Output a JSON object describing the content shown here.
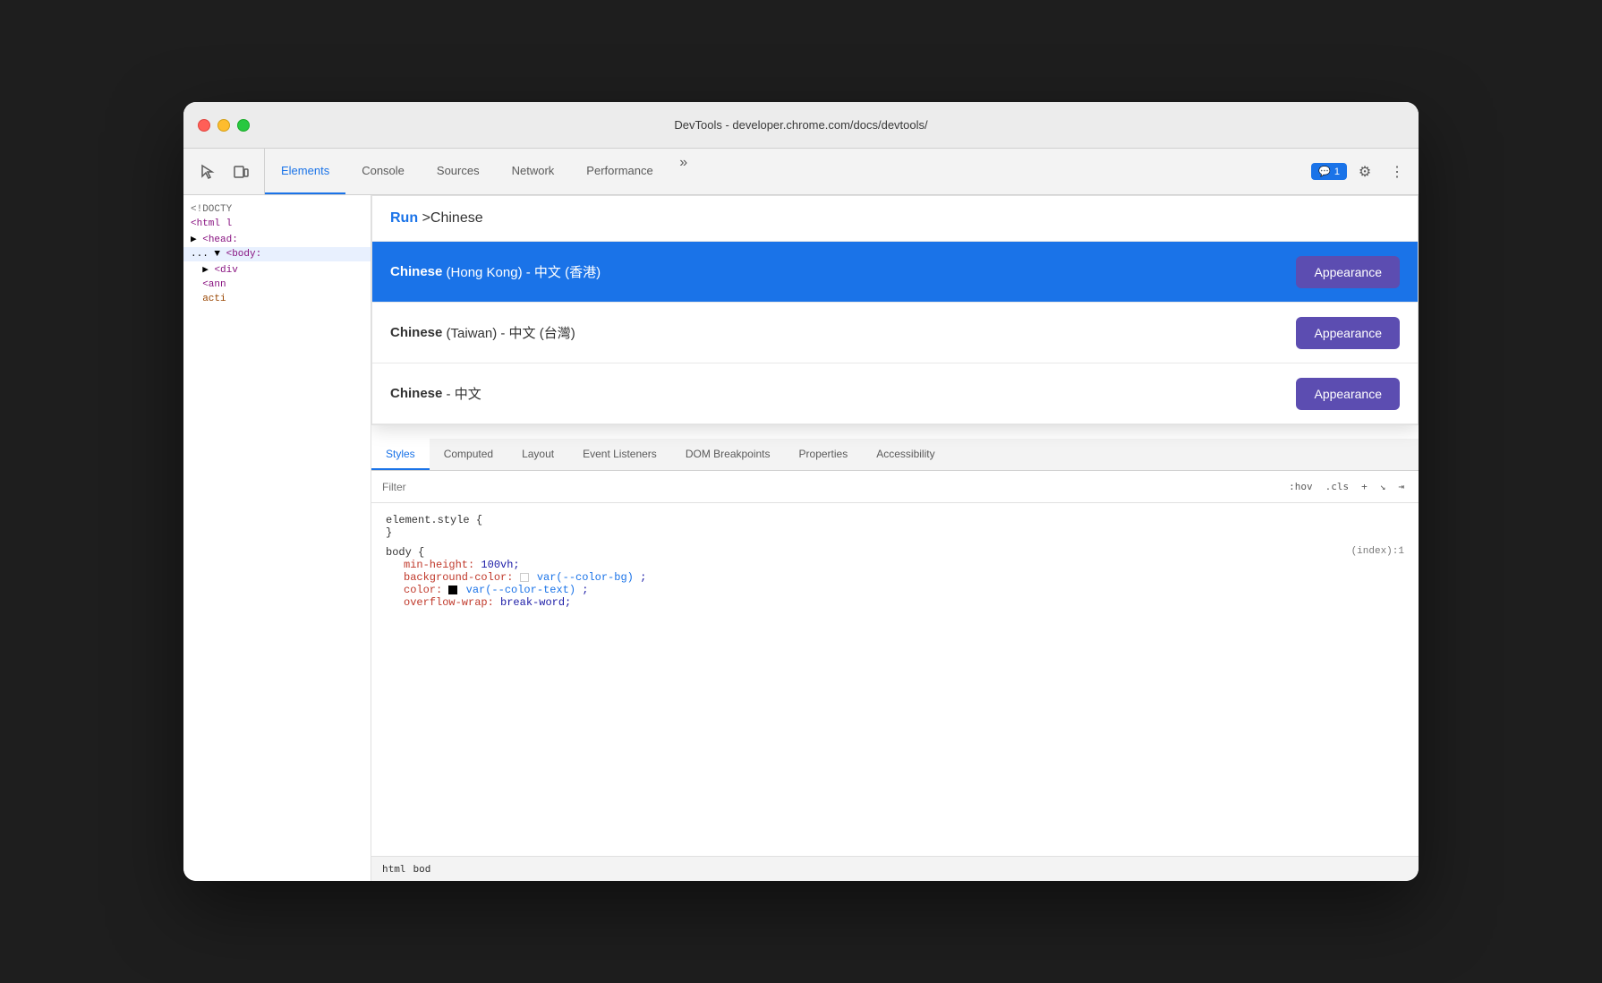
{
  "window": {
    "title": "DevTools - developer.chrome.com/docs/devtools/"
  },
  "toolbar": {
    "tabs": [
      {
        "label": "Elements",
        "active": false
      },
      {
        "label": "Console",
        "active": false
      },
      {
        "label": "Sources",
        "active": false
      },
      {
        "label": "Network",
        "active": false
      },
      {
        "label": "Performance",
        "active": false
      }
    ],
    "more_label": "»",
    "notification": "1",
    "settings_icon": "⚙",
    "menu_icon": "⋮"
  },
  "dom": {
    "lines": [
      {
        "text": "<!DOCTY",
        "type": "doctype"
      },
      {
        "text": "<html l",
        "type": "tag"
      },
      {
        "text": "▶ <head:",
        "type": "tag"
      },
      {
        "text": "... ▼ <body:",
        "type": "tag",
        "selected": true
      },
      {
        "text": "  ▶ <div",
        "type": "tag"
      },
      {
        "text": "  <ann",
        "type": "tag"
      },
      {
        "text": "  acti",
        "type": "attr"
      }
    ]
  },
  "command_palette": {
    "run_label": "Run",
    "query": ">Chinese",
    "results": [
      {
        "id": "result-1",
        "bold": "Chinese",
        "rest": " (Hong Kong) - 中文 (香港)",
        "button": "Appearance",
        "highlighted": true
      },
      {
        "id": "result-2",
        "bold": "Chinese",
        "rest": " (Taiwan) - 中文 (台灣)",
        "button": "Appearance",
        "highlighted": false
      },
      {
        "id": "result-3",
        "bold": "Chinese",
        "rest": " - 中文",
        "button": "Appearance",
        "highlighted": false
      }
    ]
  },
  "styles_tabs": [
    {
      "label": "Styles",
      "active": true
    },
    {
      "label": "Computed",
      "active": false
    },
    {
      "label": "Layout",
      "active": false
    },
    {
      "label": "Event Listeners",
      "active": false
    },
    {
      "label": "DOM Breakpoints",
      "active": false
    },
    {
      "label": "Properties",
      "active": false
    },
    {
      "label": "Accessibility",
      "active": false
    }
  ],
  "filter": {
    "placeholder": "Filter",
    "hov_label": ":hov",
    "cls_label": ".cls",
    "plus_label": "+"
  },
  "css_rules": [
    {
      "selector": "element.style {",
      "properties": [],
      "close": "}"
    },
    {
      "selector": "body {",
      "index": "(index):1",
      "properties": [
        {
          "name": "min-height:",
          "value": "100vh;",
          "type": "plain"
        },
        {
          "name": "background-color:",
          "value": "var(--color-bg);",
          "type": "var",
          "swatch": "white"
        },
        {
          "name": "color:",
          "value": "var(--color-text);",
          "type": "var",
          "swatch": "black"
        },
        {
          "name": "overflow-wrap:",
          "value": "break-word;",
          "type": "plain",
          "truncated": true
        }
      ]
    }
  ],
  "breadcrumb": {
    "items": [
      "html",
      "bod"
    ]
  }
}
